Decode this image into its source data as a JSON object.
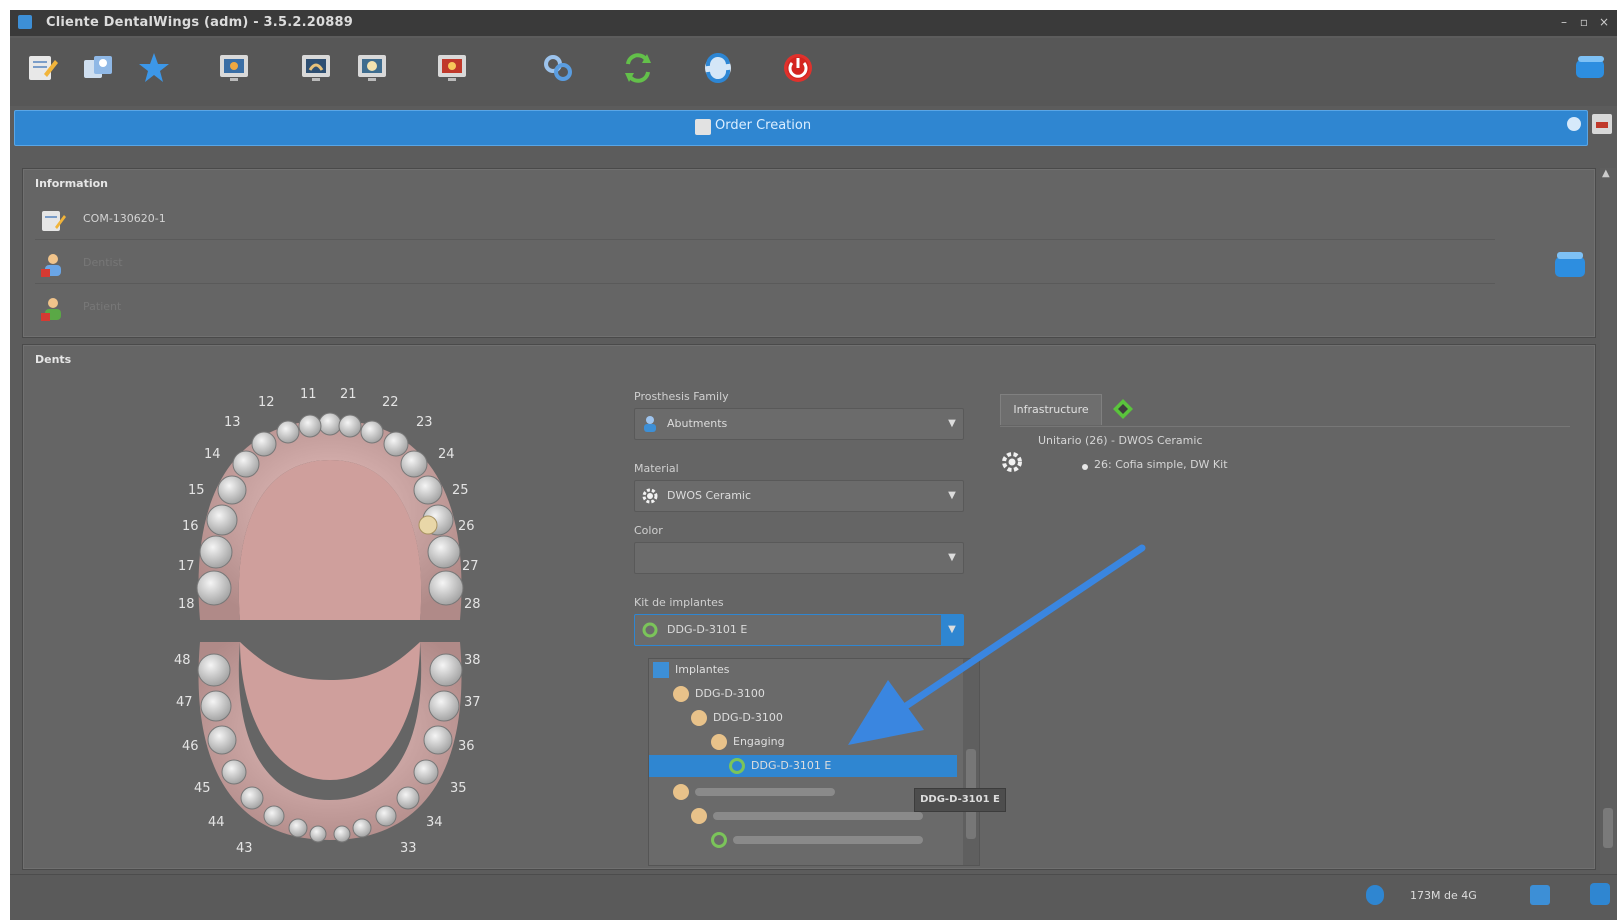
{
  "window": {
    "title": "Cliente DentalWings (adm) - 3.5.2.20889",
    "controls": [
      "–",
      "▫",
      "×"
    ]
  },
  "toolbar": {
    "icons": [
      "edit-order-icon",
      "users-icon",
      "star-icon",
      "monitor-icon",
      "scan-icon",
      "design-icon",
      "viewer-icon",
      "link-icon",
      "sync-icon",
      "transfer-icon",
      "power-icon",
      "database-icon"
    ]
  },
  "ribbon": {
    "label": "Order Creation"
  },
  "information": {
    "title": "Information",
    "order_id": "COM-130620-1",
    "patient_placeholder": "Dentist",
    "client_placeholder": "Patient"
  },
  "teeth_panel": {
    "title": "Dents",
    "upper_numbers": [
      "11",
      "21",
      "12",
      "22",
      "13",
      "23",
      "14",
      "24",
      "15",
      "25",
      "16",
      "26",
      "17",
      "27",
      "18",
      "28"
    ],
    "lower_numbers": [
      "48",
      "38",
      "47",
      "37",
      "46",
      "36",
      "45",
      "35",
      "44",
      "34",
      "43",
      "33"
    ]
  },
  "form": {
    "prosthesis_family_label": "Prosthesis Family",
    "prosthesis_family_value": "Abutments",
    "material_label": "Material",
    "material_value": "DWOS Ceramic",
    "color_label": "Color",
    "color_value": "",
    "implant_kit_label": "Kit de implantes",
    "implant_kit_value": "DDG-D-3101 E"
  },
  "tree": {
    "items": [
      {
        "label": "Implantes",
        "level": 0
      },
      {
        "label": "DDG-D-3100",
        "level": 1
      },
      {
        "label": "DDG-D-3100",
        "level": 2
      },
      {
        "label": "Engaging",
        "level": 3
      },
      {
        "label": "DDG-D-3101 E",
        "level": 4,
        "selected": true
      }
    ],
    "tooltip": "DDG-D-3101 E"
  },
  "right_panel": {
    "tab_label": "Infrastructure",
    "item_title": "Unitario (26) - DWOS Ceramic",
    "item_sub": "26: Cofia simple, DW Kit"
  },
  "status": {
    "text": "173M de 4G"
  },
  "colors": {
    "accent": "#2f86d1",
    "arrow": "#3a86e0"
  }
}
